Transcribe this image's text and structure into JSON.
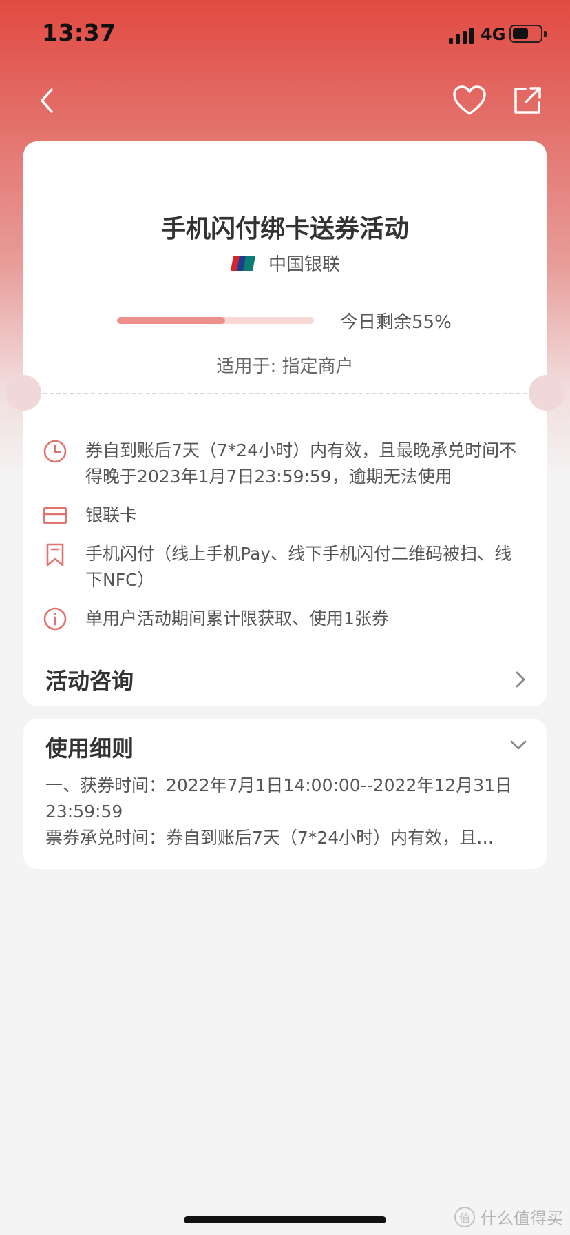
{
  "status_bar": {
    "time": "13:37",
    "network": "4G"
  },
  "activity": {
    "title": "手机闪付绑卡送券活动",
    "issuer": "中国银联",
    "progress_fraction": 0.55,
    "remaining_text": "今日剩余55%",
    "applies_to": "适用于: 指定商户"
  },
  "info_items": [
    {
      "icon": "clock-icon",
      "text": "券自到账后7天（7*24小时）内有效，且最晚承兑时间不得晚于2023年1月7日23:59:59，逾期无法使用"
    },
    {
      "icon": "card-icon",
      "text": "银联卡"
    },
    {
      "icon": "bookmark-icon",
      "text": "手机闪付（线上手机Pay、线下手机闪付二维码被扫、线下NFC）"
    },
    {
      "icon": "info-icon",
      "text": "单用户活动期间累计限获取、使用1张券"
    }
  ],
  "consult": {
    "label": "活动咨询"
  },
  "rules": {
    "title": "使用细则",
    "lines": [
      "一、获券时间：2022年7月1日14:00:00--2022年12月31日",
      "23:59:59",
      "票券承兑时间：券自到账后7天（7*24小时）内有效，且…"
    ]
  },
  "watermark": {
    "text": "什么值得买",
    "icon_glyph": "值"
  },
  "colors": {
    "accent": "#e14a42",
    "icon": "#e0736e",
    "progress_fill": "#ee8f8b",
    "progress_track": "#f7d8d7"
  }
}
